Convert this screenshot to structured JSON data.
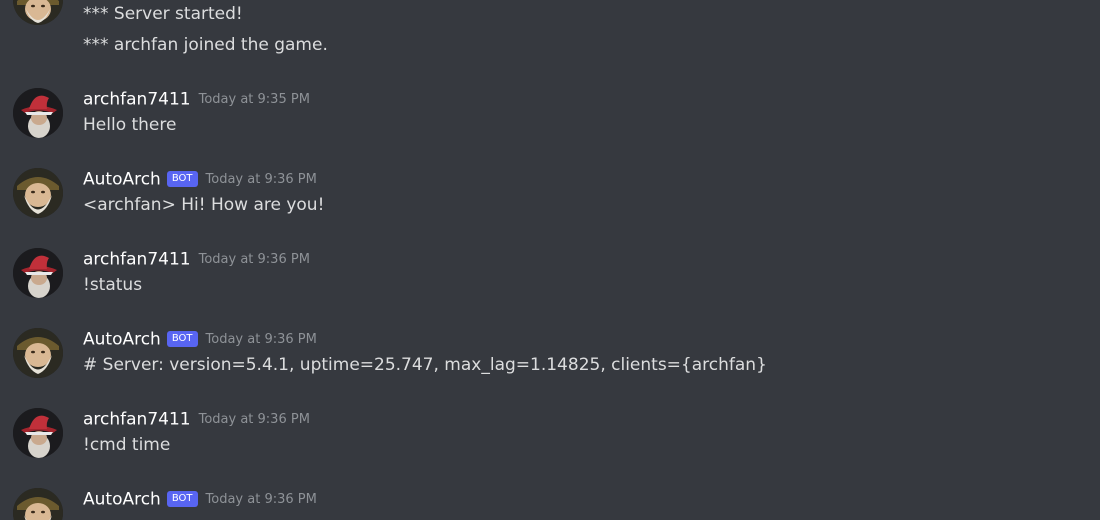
{
  "system_messages": [
    "*** Server started!",
    "*** archfan joined the game."
  ],
  "messages": [
    {
      "author": "archfan7411",
      "is_bot": false,
      "timestamp": "Today at 9:35 PM",
      "content": "Hello there",
      "avatar": "red-hat-wizard-avatar"
    },
    {
      "author": "AutoArch",
      "is_bot": true,
      "bot_tag": "BOT",
      "timestamp": "Today at 9:36 PM",
      "content": "<archfan> Hi! How are you!",
      "avatar": "bearded-wizard-avatar"
    },
    {
      "author": "archfan7411",
      "is_bot": false,
      "timestamp": "Today at 9:36 PM",
      "content": "!status",
      "avatar": "red-hat-wizard-avatar"
    },
    {
      "author": "AutoArch",
      "is_bot": true,
      "bot_tag": "BOT",
      "timestamp": "Today at 9:36 PM",
      "content": "# Server: version=5.4.1, uptime=25.747, max_lag=1.14825, clients={archfan}",
      "avatar": "bearded-wizard-avatar"
    },
    {
      "author": "archfan7411",
      "is_bot": false,
      "timestamp": "Today at 9:36 PM",
      "content": "!cmd time",
      "avatar": "red-hat-wizard-avatar"
    },
    {
      "author": "AutoArch",
      "is_bot": true,
      "bot_tag": "BOT",
      "timestamp": "Today at 9:36 PM",
      "content": "",
      "avatar": "bearded-wizard-avatar"
    }
  ],
  "colors": {
    "background": "#36393f",
    "username": "#ffffff",
    "text": "#dcddde",
    "timestamp": "#8e9297",
    "bot_tag": "#5865f2",
    "red_hat": "#c0303a"
  }
}
